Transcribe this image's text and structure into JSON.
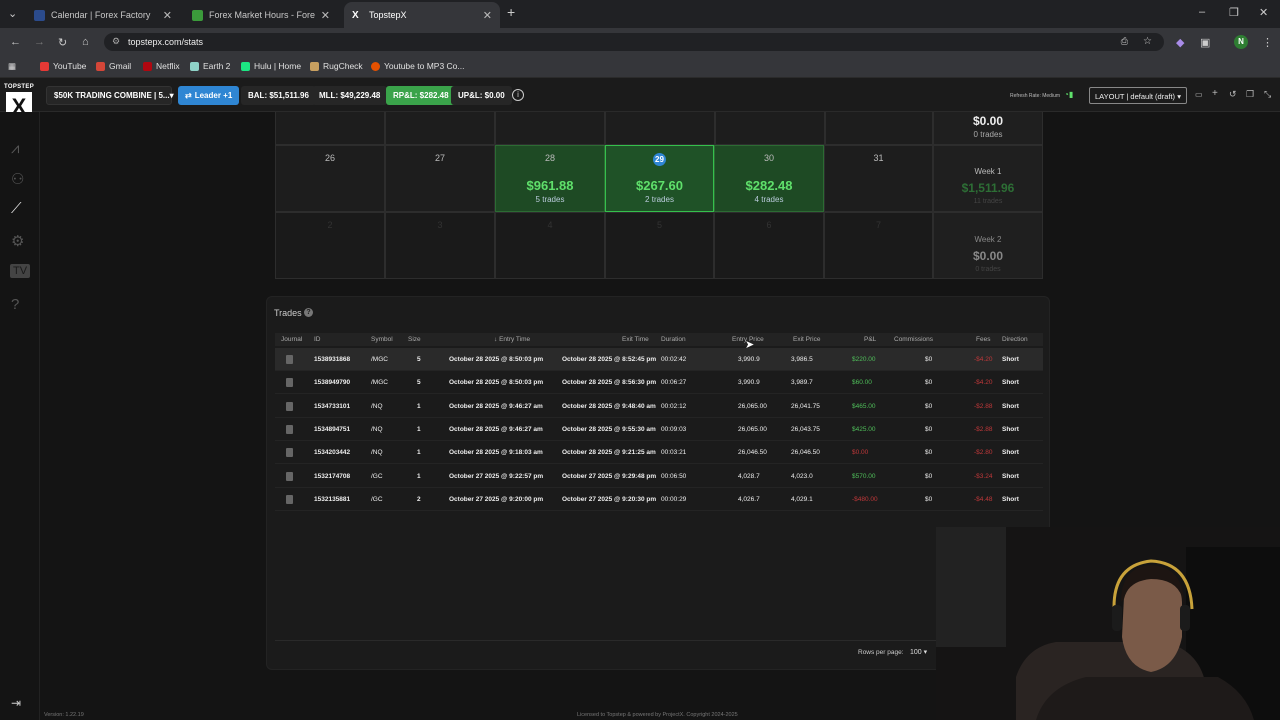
{
  "browser": {
    "tabs": [
      {
        "title": "Calendar | Forex Factory",
        "color": "#2b4b8c"
      },
      {
        "title": "Forex Market Hours - Forex Ma",
        "color": "#3b9b3b"
      },
      {
        "title": "TopstepX",
        "color": "#ffffff"
      }
    ],
    "url": "topstepx.com/stats",
    "bookmarks": [
      {
        "label": "YouTube",
        "color": "#e53935"
      },
      {
        "label": "Gmail",
        "color": "#d44638"
      },
      {
        "label": "Netflix",
        "color": "#b00710"
      },
      {
        "label": "Earth 2",
        "color": "#8fd3c8"
      },
      {
        "label": "Hulu | Home",
        "color": "#1ce783"
      },
      {
        "label": "RugCheck",
        "color": "#c8a060"
      },
      {
        "label": "Youtube to MP3 Co...",
        "color": "#e65100"
      }
    ],
    "profile_initial": "N"
  },
  "topstep": {
    "logo_text": "TOPSTEP",
    "account": "$50K TRADING COMBINE | 5...",
    "leader": "Leader +1",
    "bal": "BAL: $51,511.96",
    "mll": "MLL: $49,229.48",
    "rpl": "RP&L: $282.48",
    "upl": "UP&L: $0.00",
    "refresh": "Refresh Rate: Medium",
    "layout": "LAYOUT | default (draft)",
    "version": "Version: 1.22.19",
    "license": "Licensed to Topstep & powered by ProjectX. Copyright 2024-2025"
  },
  "calendar": {
    "top_summary": {
      "amount": "$0.00",
      "trades": "0 trades"
    },
    "days": [
      {
        "day": "26",
        "amount": "",
        "trades": ""
      },
      {
        "day": "27",
        "amount": "",
        "trades": ""
      },
      {
        "day": "28",
        "amount": "$961.88",
        "trades": "5 trades"
      },
      {
        "day": "29",
        "amount": "$267.60",
        "trades": "2 trades"
      },
      {
        "day": "30",
        "amount": "$282.48",
        "trades": "4 trades"
      },
      {
        "day": "31",
        "amount": "",
        "trades": ""
      }
    ],
    "week1": {
      "label": "Week 1",
      "amount": "$1,511.96",
      "trades": "11 trades"
    },
    "next_days": [
      "2",
      "3",
      "4",
      "5",
      "6",
      "7"
    ],
    "week2": {
      "label": "Week 2",
      "amount": "$0.00",
      "trades": "0 trades"
    }
  },
  "trades": {
    "title": "Trades",
    "columns": [
      "Journal",
      "ID",
      "Symbol",
      "Size",
      "Entry Time",
      "Exit Time",
      "Duration",
      "Entry Price",
      "Exit Price",
      "P&L",
      "Commissions",
      "Fees",
      "Direction"
    ],
    "rows": [
      {
        "id": "1538931868",
        "symbol": "/MGC",
        "size": "5",
        "entry": "October 28 2025 @ 8:50:03 pm",
        "exit": "October 28 2025 @ 8:52:45 pm",
        "duration": "00:02:42",
        "entry_price": "3,990.9",
        "exit_price": "3,986.5",
        "pnl": "$220.00",
        "pnl_sign": "gain",
        "comm": "$0",
        "fees": "-$4.20",
        "dir": "Short"
      },
      {
        "id": "1538949790",
        "symbol": "/MGC",
        "size": "5",
        "entry": "October 28 2025 @ 8:50:03 pm",
        "exit": "October 28 2025 @ 8:56:30 pm",
        "duration": "00:06:27",
        "entry_price": "3,990.9",
        "exit_price": "3,989.7",
        "pnl": "$60.00",
        "pnl_sign": "gain",
        "comm": "$0",
        "fees": "-$4.20",
        "dir": "Short"
      },
      {
        "id": "1534733101",
        "symbol": "/NQ",
        "size": "1",
        "entry": "October 28 2025 @ 9:46:27 am",
        "exit": "October 28 2025 @ 9:48:40 am",
        "duration": "00:02:12",
        "entry_price": "26,065.00",
        "exit_price": "26,041.75",
        "pnl": "$465.00",
        "pnl_sign": "gain",
        "comm": "$0",
        "fees": "-$2.88",
        "dir": "Short"
      },
      {
        "id": "1534894751",
        "symbol": "/NQ",
        "size": "1",
        "entry": "October 28 2025 @ 9:46:27 am",
        "exit": "October 28 2025 @ 9:55:30 am",
        "duration": "00:09:03",
        "entry_price": "26,065.00",
        "exit_price": "26,043.75",
        "pnl": "$425.00",
        "pnl_sign": "gain",
        "comm": "$0",
        "fees": "-$2.88",
        "dir": "Short"
      },
      {
        "id": "1534203442",
        "symbol": "/NQ",
        "size": "1",
        "entry": "October 28 2025 @ 9:18:03 am",
        "exit": "October 28 2025 @ 9:21:25 am",
        "duration": "00:03:21",
        "entry_price": "26,046.50",
        "exit_price": "26,046.50",
        "pnl": "$0.00",
        "pnl_sign": "loss",
        "comm": "$0",
        "fees": "-$2.80",
        "dir": "Short"
      },
      {
        "id": "1532174708",
        "symbol": "/GC",
        "size": "1",
        "entry": "October 27 2025 @ 9:22:57 pm",
        "exit": "October 27 2025 @ 9:29:48 pm",
        "duration": "00:06:50",
        "entry_price": "4,028.7",
        "exit_price": "4,023.0",
        "pnl": "$570.00",
        "pnl_sign": "gain",
        "comm": "$0",
        "fees": "-$3.24",
        "dir": "Short"
      },
      {
        "id": "1532135881",
        "symbol": "/GC",
        "size": "2",
        "entry": "October 27 2025 @ 9:20:00 pm",
        "exit": "October 27 2025 @ 9:20:30 pm",
        "duration": "00:00:29",
        "entry_price": "4,026.7",
        "exit_price": "4,029.1",
        "pnl": "-$480.00",
        "pnl_sign": "loss",
        "comm": "$0",
        "fees": "-$4.48",
        "dir": "Short"
      }
    ],
    "rows_per_page_label": "Rows per page:",
    "rows_per_page": "100"
  }
}
